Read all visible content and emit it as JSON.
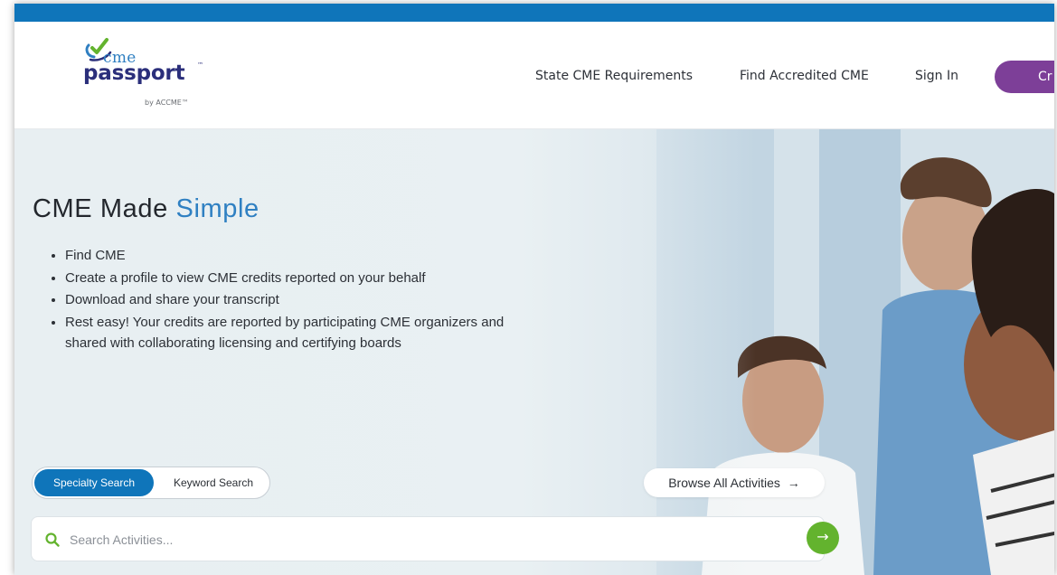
{
  "brand": {
    "logo_cme": "cme",
    "logo_passport": "passport",
    "logo_tm": "™",
    "logo_byline": "by ACCME™"
  },
  "nav": {
    "state_requirements": "State CME Requirements",
    "find_accredited": "Find Accredited CME",
    "sign_in": "Sign In",
    "create_label": "Cr"
  },
  "hero": {
    "title_main": "CME Made ",
    "title_accent": "Simple",
    "bullets": [
      "Find CME",
      "Create a profile to view CME credits reported on your behalf",
      "Download and share your transcript",
      "Rest easy! Your credits are reported by participating CME organizers and shared with collaborating licensing and certifying boards"
    ]
  },
  "search": {
    "tabs": [
      "Specialty Search",
      "Keyword Search"
    ],
    "active_tab": "Specialty Search",
    "browse_label": "Browse All Activities",
    "browse_arrow": "→",
    "placeholder": "Search Activities...",
    "value": "",
    "go_arrow": "→"
  },
  "colors": {
    "brand_blue": "#0f75ba",
    "accent_purple": "#7d3f98",
    "go_green": "#63b32e",
    "title_accent": "#2f80c2"
  },
  "icons": {
    "logo": "checkmark-logo-icon",
    "search": "search-icon",
    "browse": "arrow-right-icon",
    "go": "arrow-right-icon"
  }
}
